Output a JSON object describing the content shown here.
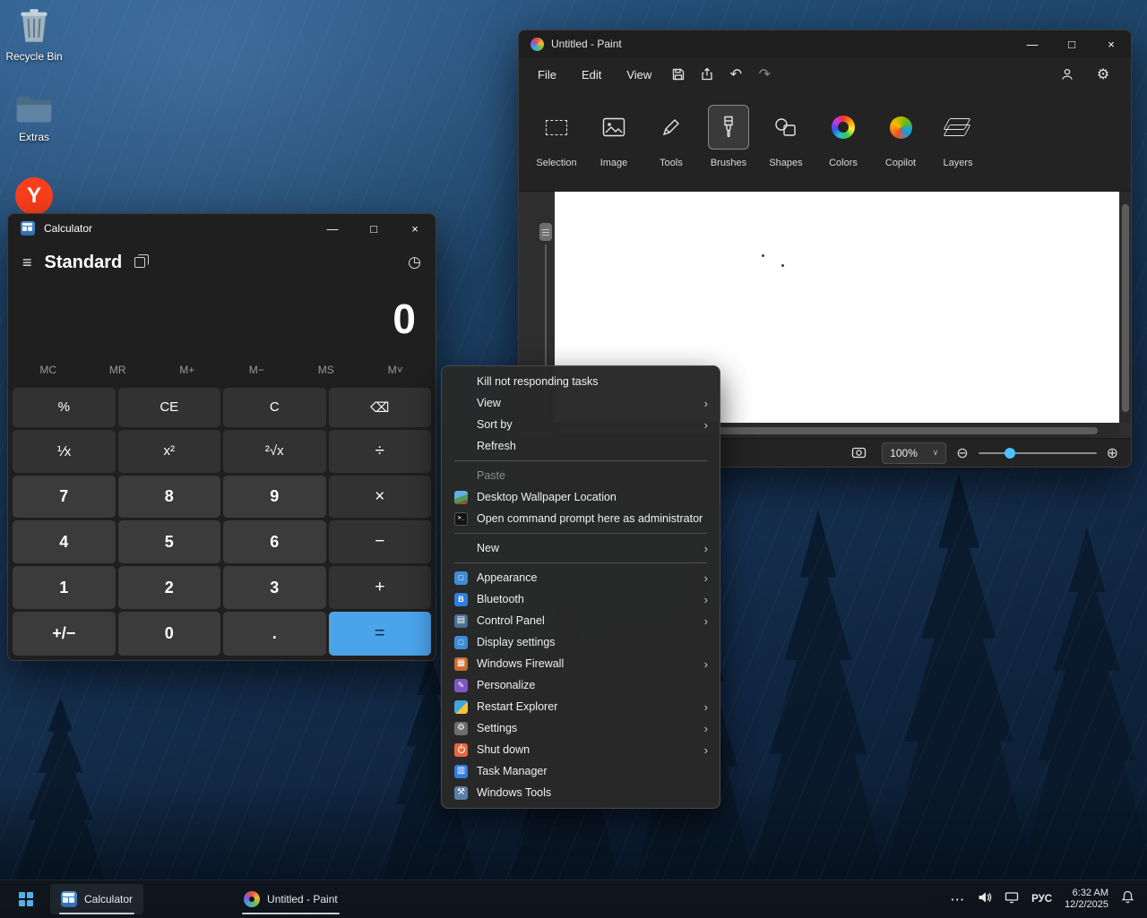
{
  "icons": {
    "chevron_right": "›",
    "minimize": "—",
    "maximize": "□",
    "close": "×",
    "hamburger": "≡",
    "history": "◷",
    "undo": "↶",
    "redo": "↷",
    "settings_gear": "⚙",
    "dropdown": "∨",
    "zoom_out": "⊖",
    "zoom_in": "⊕"
  },
  "desktop": {
    "icons": [
      {
        "label": "Recycle Bin"
      },
      {
        "label": "Extras"
      }
    ],
    "yandex_glyph": "Y"
  },
  "calculator": {
    "title": "Calculator",
    "mode_label": "Standard",
    "display_value": "0",
    "memory_keys": [
      "MC",
      "MR",
      "M+",
      "M−",
      "MS",
      "M˅"
    ],
    "keys_rows": [
      [
        "%",
        "CE",
        "C",
        "⌫"
      ],
      [
        "⅟x",
        "x²",
        "²√x",
        "÷"
      ],
      [
        "7",
        "8",
        "9",
        "×"
      ],
      [
        "4",
        "5",
        "6",
        "−"
      ],
      [
        "1",
        "2",
        "3",
        "+"
      ],
      [
        "+/−",
        "0",
        ".",
        "="
      ]
    ]
  },
  "paint": {
    "title": "Untitled - Paint",
    "menus": [
      "File",
      "Edit",
      "View"
    ],
    "toolbar_groups": [
      "Selection",
      "Image",
      "Tools",
      "Brushes",
      "Shapes",
      "Colors",
      "Copilot",
      "Layers"
    ],
    "zoom_value": "100%"
  },
  "context_menu": {
    "items": [
      {
        "label": "Kill not responding tasks"
      },
      {
        "label": "View"
      },
      {
        "label": "Sort by"
      },
      {
        "label": "Refresh"
      },
      {
        "label": "Paste"
      },
      {
        "label": "Desktop Wallpaper Location"
      },
      {
        "label": "Open command prompt here as administrator",
        "glyph": ">_"
      },
      {
        "label": "New"
      },
      {
        "label": "Appearance",
        "glyph": "□"
      },
      {
        "label": "Bluetooth",
        "glyph": "B"
      },
      {
        "label": "Control Panel",
        "glyph": "▤"
      },
      {
        "label": "Display settings",
        "glyph": "□"
      },
      {
        "label": "Windows Firewall",
        "glyph": "▦"
      },
      {
        "label": "Personalize",
        "glyph": "✎"
      },
      {
        "label": "Restart Explorer"
      },
      {
        "label": "Settings",
        "glyph": "⚙"
      },
      {
        "label": "Shut down"
      },
      {
        "label": "Task Manager",
        "glyph": "▥"
      },
      {
        "label": "Windows Tools",
        "glyph": "⚒"
      }
    ]
  },
  "taskbar": {
    "apps": [
      {
        "label": "Calculator"
      },
      {
        "label": "Untitled - Paint"
      }
    ],
    "tray": {
      "overflow": "···",
      "language": "РУС",
      "time": "6:32 AM",
      "date": "12/2/2025"
    }
  }
}
